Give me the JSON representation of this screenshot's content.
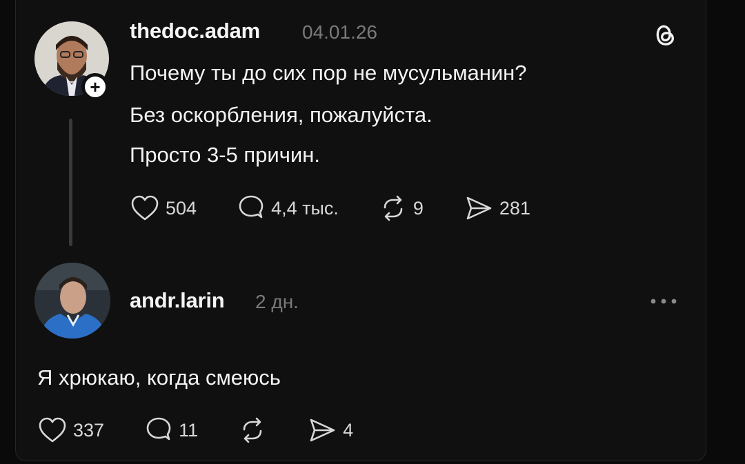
{
  "post": {
    "username": "thedoc.adam",
    "timestamp": "04.01.26",
    "lines": [
      "Почему ты до сих пор не мусульманин?",
      "Без оскорбления, пожалуйста.",
      "Просто 3-5 причин."
    ],
    "stats": {
      "likes": "504",
      "comments": "4,4 тыс.",
      "reposts": "9",
      "shares": "281"
    },
    "follow_badge": "+"
  },
  "reply": {
    "username": "andr.larin",
    "timestamp": "2 дн.",
    "text": "Я хрюкаю, когда смеюсь",
    "stats": {
      "likes": "337",
      "comments": "11",
      "reposts": "",
      "shares": "4"
    }
  },
  "icons": {
    "brand": "threads-logo-icon",
    "like": "heart-icon",
    "comment": "comment-bubble-icon",
    "repost": "repost-arrows-icon",
    "share": "send-icon",
    "more": "more-dots-icon"
  },
  "colors": {
    "background": "#101010",
    "text": "#f3f3f3",
    "muted": "#7a7a7a",
    "badge": "#ffffff"
  }
}
